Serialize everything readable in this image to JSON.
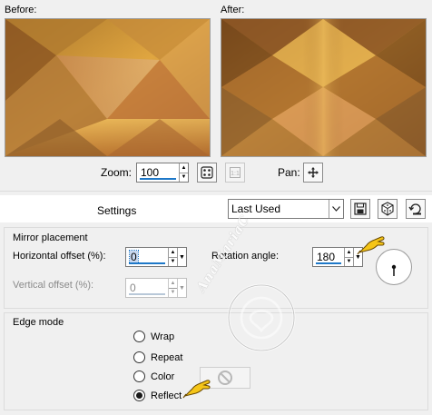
{
  "preview": {
    "before_label": "Before:",
    "after_label": "After:"
  },
  "zoom": {
    "label": "Zoom:",
    "value": "100",
    "pan_label": "Pan:"
  },
  "settings": {
    "label": "Settings",
    "preset_value": "Last Used"
  },
  "mirror_placement": {
    "title": "Mirror placement",
    "horizontal_offset_label": "Horizontal offset (%):",
    "horizontal_offset_value": "0",
    "vertical_offset_label": "Vertical offset (%):",
    "vertical_offset_value": "0",
    "rotation_angle_label": "Rotation angle:",
    "rotation_angle_value": "180"
  },
  "edge_mode": {
    "title": "Edge mode",
    "options": [
      "Wrap",
      "Repeat",
      "Color",
      "Reflect"
    ],
    "selected": "Reflect"
  },
  "watermark_text": "AnaMariaC",
  "colors": {
    "accent_underline": "#1e78c8",
    "pointer_yellow": "#f5c518"
  },
  "icons": {
    "preview_toggle": "preview-toggle-icon",
    "zoom_fit": "zoom-fit-icon",
    "pan": "pan-move-icon",
    "save_preset": "save-preset-icon",
    "randomize": "randomize-dice-icon",
    "reset": "reset-defaults-icon",
    "color_disabled": "no-color-icon"
  }
}
